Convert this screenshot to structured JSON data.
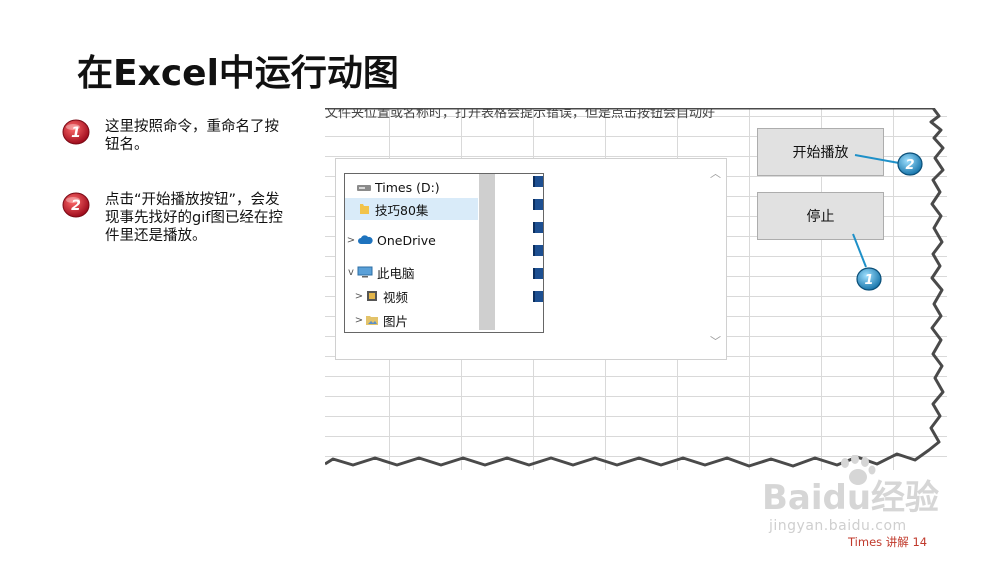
{
  "title": "在Excel中运行动图",
  "steps": [
    {
      "number": "1",
      "text": "这里按照命令，重命名了按钮名。"
    },
    {
      "number": "2",
      "text": "点击“开始播放按钮”，会发现事先找好的gif图已经在控件里还是播放。"
    }
  ],
  "excel": {
    "cut_text": "文件夹位置或名称时，打开表格会提示错误，但是点击按钮会自动好",
    "buttons": {
      "play": "开始播放",
      "stop": "停止"
    },
    "callouts": {
      "play": "2",
      "stop": "1"
    },
    "explorer": {
      "items": [
        {
          "label": "Times (D:)",
          "icon": "drive-icon",
          "expander": ""
        },
        {
          "label": "技巧80集",
          "icon": "folder-icon",
          "expander": ""
        },
        {
          "label": "OneDrive",
          "icon": "cloud-icon",
          "expander": ">"
        },
        {
          "label": "此电脑",
          "icon": "computer-icon",
          "expander": "v"
        },
        {
          "label": "视频",
          "icon": "video-folder-icon",
          "expander": ">"
        },
        {
          "label": "图片",
          "icon": "picture-folder-icon",
          "expander": ">"
        }
      ]
    }
  },
  "watermark": {
    "brand": "Baidu经验",
    "url": "jingyan.baidu.com"
  },
  "footer": "Times 讲解 14",
  "colors": {
    "badge_red": "#c8102e",
    "callout_blue": "#1e90c8",
    "footer_red": "#c0392b"
  }
}
